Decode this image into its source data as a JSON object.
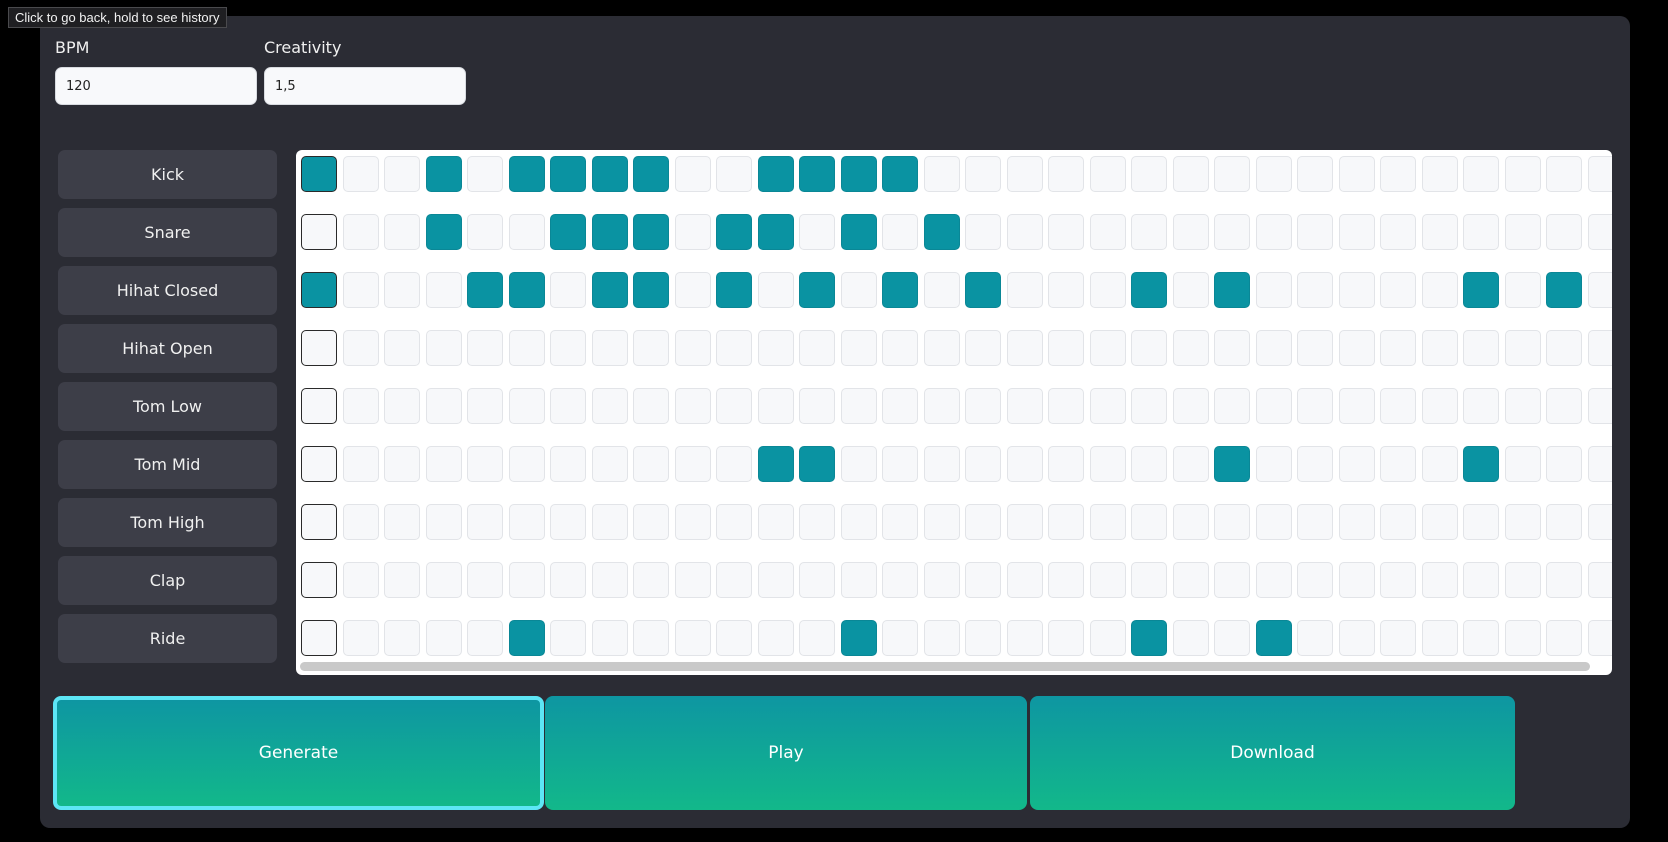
{
  "tooltip": "Click to go back, hold to see history",
  "bpm": {
    "label": "BPM",
    "value": "120"
  },
  "creativity": {
    "label": "Creativity",
    "value": "1,5"
  },
  "tracks": [
    {
      "label": "Kick",
      "steps": [
        0,
        3,
        5,
        6,
        7,
        8,
        11,
        12,
        13,
        14
      ]
    },
    {
      "label": "Snare",
      "steps": [
        3,
        6,
        7,
        8,
        10,
        11,
        13,
        15
      ]
    },
    {
      "label": "Hihat Closed",
      "steps": [
        0,
        4,
        5,
        7,
        8,
        10,
        12,
        14,
        16,
        20,
        22,
        28,
        30
      ]
    },
    {
      "label": "Hihat Open",
      "steps": []
    },
    {
      "label": "Tom Low",
      "steps": []
    },
    {
      "label": "Tom Mid",
      "steps": [
        11,
        12,
        22,
        28
      ]
    },
    {
      "label": "Tom High",
      "steps": []
    },
    {
      "label": "Clap",
      "steps": []
    },
    {
      "label": "Ride",
      "steps": [
        5,
        13,
        20,
        23
      ]
    }
  ],
  "visible_steps": 32,
  "active_step": 0,
  "buttons": {
    "generate": "Generate",
    "play": "Play",
    "download": "Download"
  },
  "colors": {
    "active_step": "#0a93a2",
    "button_top": "#0e96a2",
    "button_bottom": "#12b88a",
    "focus_ring": "#5de6f5"
  }
}
